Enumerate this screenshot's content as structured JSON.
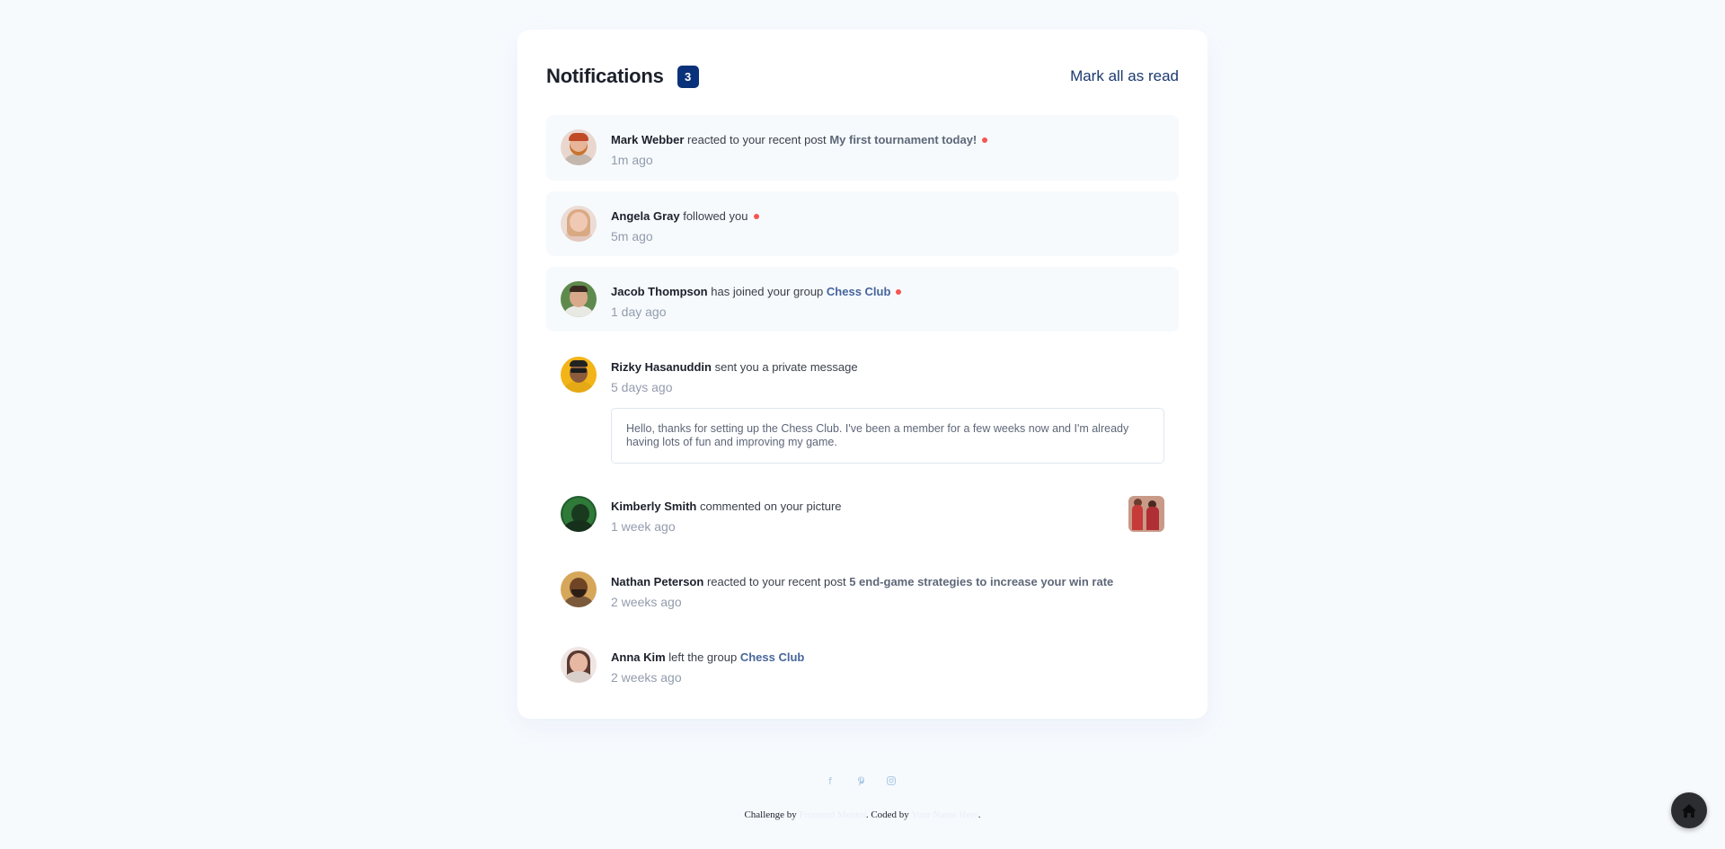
{
  "header": {
    "title": "Notifications",
    "unread_count": "3",
    "mark_all_label": "Mark all as read"
  },
  "notifications": [
    {
      "name": "Mark Webber",
      "action": "reacted to your recent post",
      "target": "My first tournament today!",
      "time": "1m ago",
      "unread": true
    },
    {
      "name": "Angela Gray",
      "action": "followed you",
      "target": "",
      "time": "5m ago",
      "unread": true
    },
    {
      "name": "Jacob Thompson",
      "action": "has joined your group",
      "target": "Chess Club",
      "time": "1 day ago",
      "unread": true
    },
    {
      "name": "Rizky Hasanuddin",
      "action": "sent you a private message",
      "target": "",
      "time": "5 days ago",
      "unread": false,
      "message": "Hello, thanks for setting up the Chess Club. I've been a member for a few weeks now and I'm already having lots of fun and improving my game."
    },
    {
      "name": "Kimberly Smith",
      "action": "commented on your picture",
      "target": "",
      "time": "1 week ago",
      "unread": false
    },
    {
      "name": "Nathan Peterson",
      "action": "reacted to your recent post",
      "target": "5 end-game strategies to increase your win rate",
      "time": "2 weeks ago",
      "unread": false
    },
    {
      "name": "Anna Kim",
      "action": "left the group",
      "target": "Chess Club",
      "time": "2 weeks ago",
      "unread": false
    }
  ],
  "footer": {
    "social_icons": [
      "facebook-icon",
      "pinterest-icon",
      "instagram-icon"
    ],
    "challenge_prefix": "Challenge by",
    "challenge_link": "Frontend Mentor",
    "coded_prefix": ". Coded by",
    "coded_link": "Your Name Here",
    "suffix": "."
  },
  "colors": {
    "background": "#f7fafd",
    "badge": "#0a327b",
    "unread_bg": "#f6fafd",
    "dot": "#f65552"
  }
}
